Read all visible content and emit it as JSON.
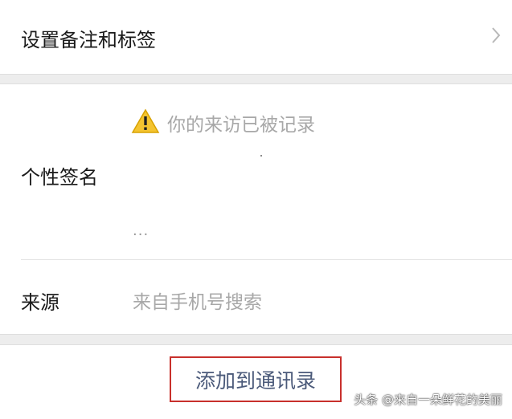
{
  "remark_row": {
    "label": "设置备注和标签"
  },
  "signature_row": {
    "label": "个性签名",
    "warning_text": "你的来访已被记录",
    "ellipsis": "...",
    "icon": "warning-icon"
  },
  "source_row": {
    "label": "来源",
    "value": "来自手机号搜索"
  },
  "action": {
    "add_label": "添加到通讯录"
  },
  "watermark": "头条 @来自一朵鲜花的美丽",
  "colors": {
    "background": "#ededed",
    "link_text": "#4b5a7a",
    "highlight_border": "#c8302c",
    "secondary_text": "#a8a8a8"
  }
}
